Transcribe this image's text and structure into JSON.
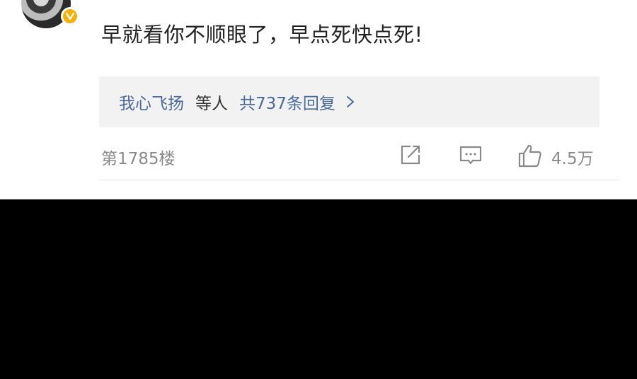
{
  "comment": {
    "text": "早就看你不顺眼了，早点死快点死!",
    "avatar_icon": "avatar-image",
    "verified_icon": "verified-v-badge-icon"
  },
  "replies": {
    "user": "我心飞扬",
    "etc": "等人",
    "count_text": "共737条回复",
    "chevron_icon": "chevron-right-icon"
  },
  "footer": {
    "floor": "第1785楼",
    "share_icon": "share-icon",
    "comment_icon": "comment-icon",
    "like_icon": "thumbs-up-icon",
    "like_count": "4.5万"
  },
  "colors": {
    "link_blue": "#4b6a9b",
    "gray_text": "#8a8a8a",
    "badge_gold": "#f5b00a"
  }
}
